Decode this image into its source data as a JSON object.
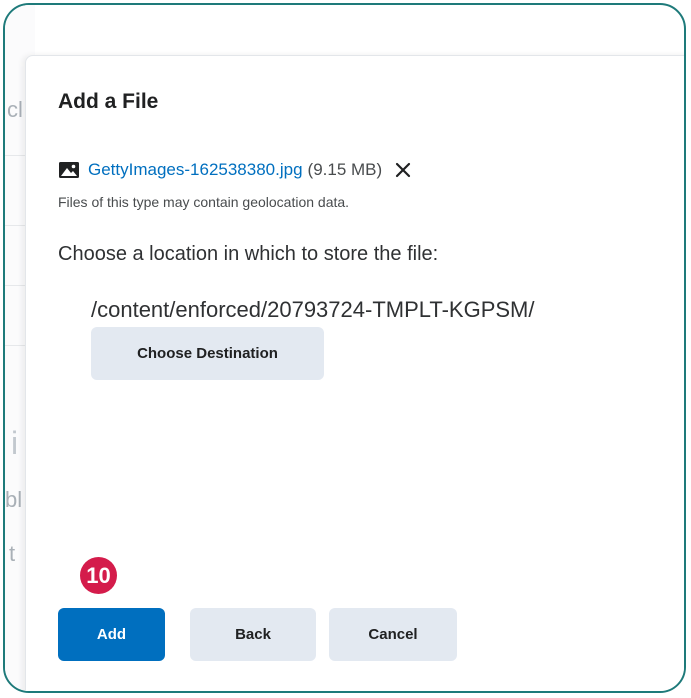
{
  "dialog": {
    "title": "Add a File",
    "file_name": "GettyImages-162538380.jpg",
    "file_size": "(9.15 MB)",
    "geolocation_note": "Files of this type may contain geolocation data.",
    "choose_location_label": "Choose a location in which to store the file:",
    "destination_path": "/content/enforced/20793724-TMPLT-KGPSM/",
    "choose_destination_label": "Choose Destination",
    "footer": {
      "add_label": "Add",
      "back_label": "Back",
      "cancel_label": "Cancel"
    }
  },
  "step_badge": {
    "number": "10",
    "color": "#d41c4b"
  },
  "background_fragments": [
    "cl",
    "i",
    "bl",
    "t"
  ],
  "icons": {
    "file_type": "image-icon",
    "remove": "close-icon"
  },
  "colors": {
    "accent": "#006fbf",
    "frame": "#1e7a7a",
    "secondary_button": "#e3e9f1"
  }
}
